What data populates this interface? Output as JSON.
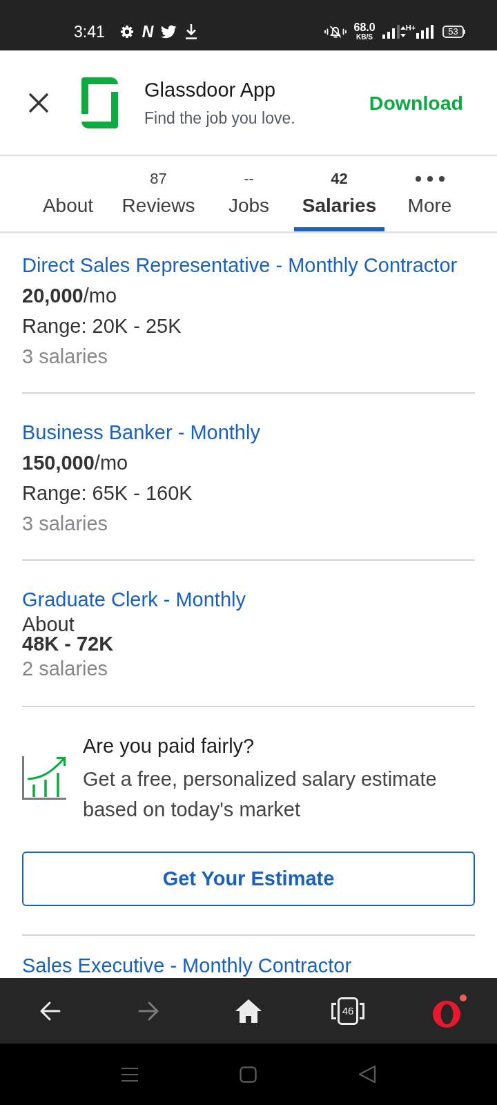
{
  "status_bar": {
    "time": "3:41",
    "app_letter": "N",
    "speed": "68.0",
    "speed_unit": "KB/S",
    "network": "H+",
    "battery": "53"
  },
  "app_banner": {
    "title": "Glassdoor App",
    "subtitle": "Find the job you love.",
    "action": "Download"
  },
  "tabs": [
    {
      "kind": "plain",
      "label": "About",
      "selected": false
    },
    {
      "kind": "count",
      "count": "87",
      "label": "Reviews",
      "selected": false
    },
    {
      "kind": "count",
      "count": "--",
      "label": "Jobs",
      "selected": false
    },
    {
      "kind": "count",
      "count": "42",
      "label": "Salaries",
      "selected": true
    },
    {
      "kind": "menu",
      "label": "More",
      "selected": false
    }
  ],
  "feed": [
    {
      "kind": "salary",
      "title": "Direct Sales Representative - Monthly Contractor",
      "pay": "**20,000**/mo",
      "range": "Range: 20K - 25K",
      "count": "3 salaries"
    },
    {
      "kind": "salary",
      "title": "Business Banker - Monthly",
      "pay": "**150,000**/mo",
      "range": "Range: 65K - 160K",
      "count": "3 salaries"
    },
    {
      "kind": "estimate",
      "title": "Graduate Clerk - Monthly",
      "lead": "About",
      "range": "48K - 72K",
      "count": "2 salaries"
    },
    {
      "kind": "promo",
      "title": "Are you paid fairly?",
      "text": "Get a free, personalized salary estimate based on today's market",
      "button": "Get Your Estimate"
    },
    {
      "kind": "salary",
      "title": "Sales Executive - Monthly Contractor"
    }
  ],
  "browser_toolbar": {
    "buttons": [
      {
        "kind": "back",
        "disabled": false
      },
      {
        "kind": "forward",
        "disabled": true
      },
      {
        "kind": "home",
        "disabled": false
      },
      {
        "kind": "tabs",
        "count": "46",
        "disabled": false
      },
      {
        "kind": "menu",
        "disabled": false,
        "badge": true
      }
    ]
  }
}
